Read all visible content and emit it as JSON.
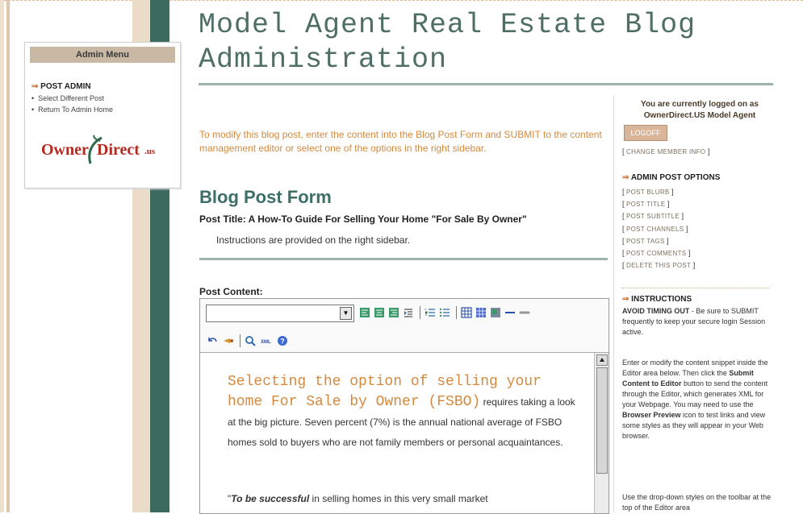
{
  "title": "Model Agent Real Estate Blog Administration",
  "admin_menu": {
    "heading": "Admin Menu",
    "section": "POST ADMIN",
    "links": [
      "Select Different Post",
      "Return To Admin Home"
    ],
    "logo": {
      "word1": "Owner",
      "word2": "Direct",
      "word3": ".us"
    }
  },
  "intro": "To modify this blog post, enter the content into the Blog Post Form and SUBMIT to the content management editor or select one of the options in the right sidebar.",
  "form": {
    "heading": "Blog Post Form",
    "post_title": "Post Title: A How-To Guide For Selling Your Home \"For Sale By Owner\"",
    "instructions": "Instructions are provided on the right sidebar.",
    "content_label": "Post Content:"
  },
  "editor": {
    "style_select_value": "",
    "toolbar_icons": [
      "align-left-icon",
      "align-center-icon",
      "align-right-icon",
      "indent-icon",
      "ordered-list-icon",
      "unordered-list-icon",
      "table-icon",
      "table-props-icon",
      "image-icon",
      "horizontal-rule-icon",
      "link-icon",
      "undo-icon",
      "cut-icon",
      "preview-icon",
      "xml-icon",
      "help-icon"
    ],
    "lead_large": "Selecting the option of selling your home For Sale by Owner (FSBO)",
    "lead_rest": " requires taking a look at the big picture. Seven percent (7%) is the annual national average of FSBO homes sold to buyers who are not family members or personal acquaintances.",
    "para2_quote": "\"",
    "para2_bold": "To be successful",
    "para2_rest": " in selling homes in this very small market"
  },
  "sidebar": {
    "logged_in_line1": "You are currently logged on as",
    "logged_in_line2": "OwnerDirect.US Model Agent",
    "logoff": "LOGOFF",
    "change_member_info": "CHANGE MEMBER INFO",
    "options_heading": "ADMIN POST OPTIONS",
    "options": [
      "POST BLURB",
      "POST TITLE",
      "POST SUBTITLE",
      "POST CHANNELS",
      "POST TAGS",
      "POST COMMENTS",
      "DELETE THIS POST"
    ],
    "instructions_heading": "INSTRUCTIONS",
    "avoid_bold": "AVOID TIMING OUT",
    "avoid_rest": " - Be sure to SUBMIT frequently to keep your secure login Session active.",
    "p2_a": "Enter or modify the content snippet inside the Editor area below. Then click the ",
    "p2_b": "Submit Content to Editor",
    "p2_c": " button to send the content through the Editor, which generates XML for your Webpage. You may need to use the ",
    "p2_d": "Browser Preview",
    "p2_e": " icon to test links and view some styles as they will appear in your Web browser.",
    "p3": "Use the drop-down styles on the toolbar at the top of the Editor area"
  },
  "colors": {
    "accent_green": "#3c6a5f",
    "title_green": "#4f6f66",
    "orange_text": "#d48a3e",
    "logo_red": "#b32a22"
  }
}
